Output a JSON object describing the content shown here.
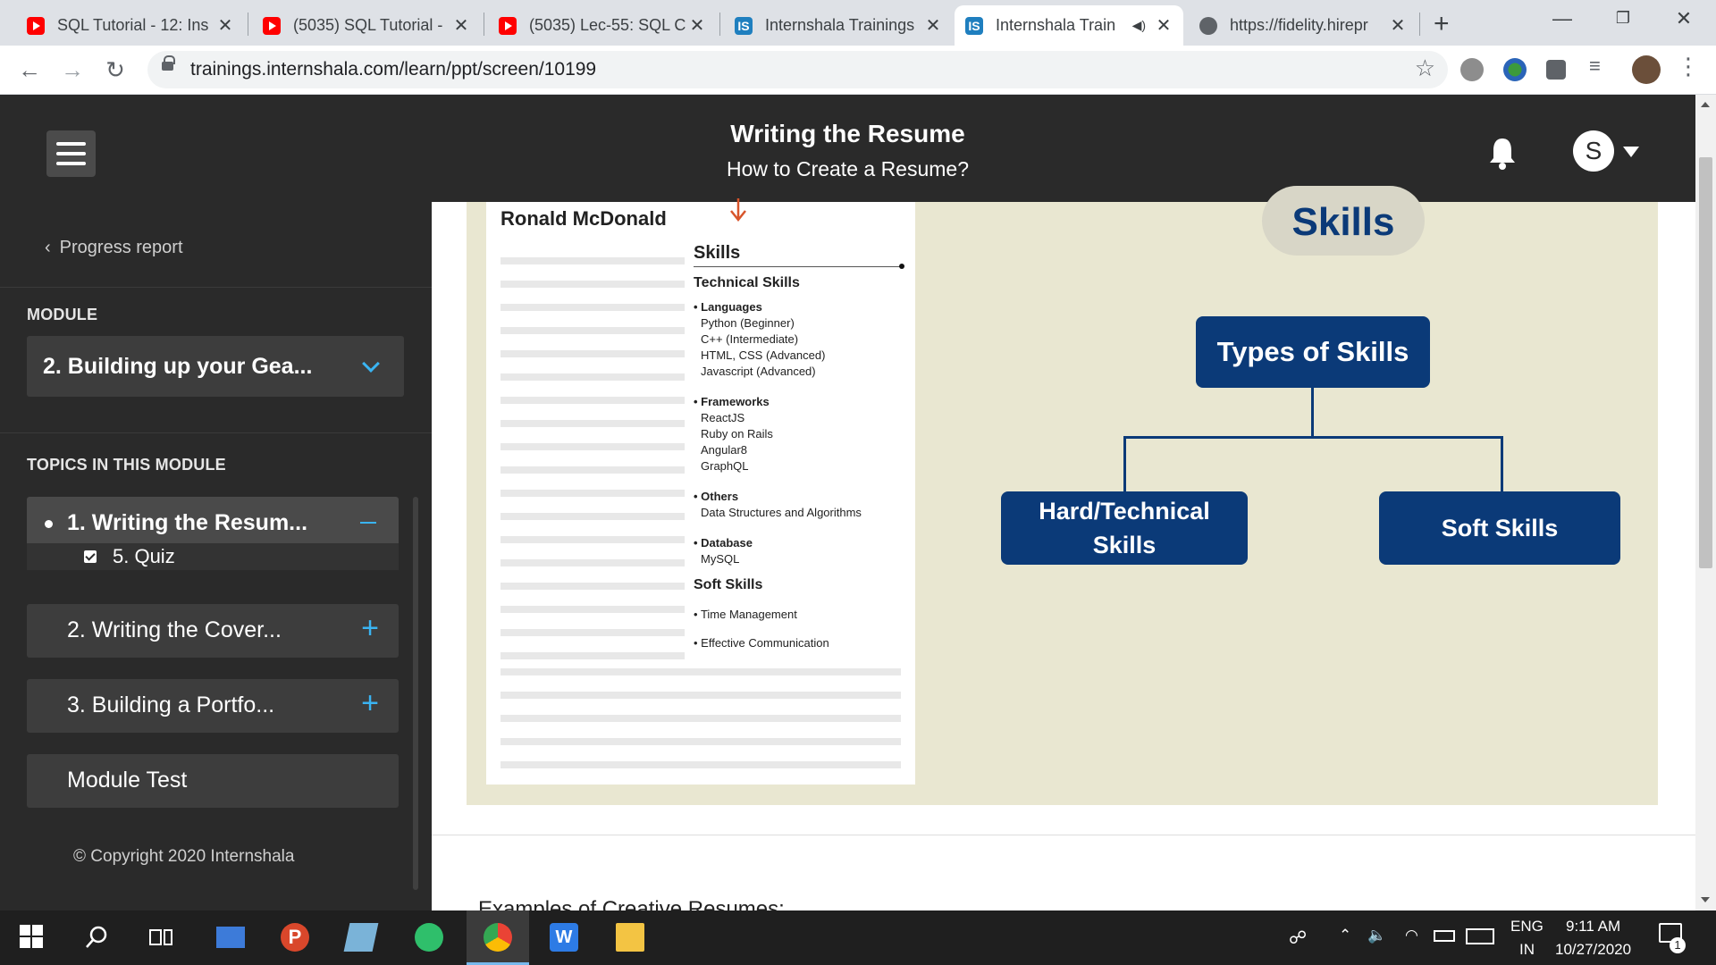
{
  "browser": {
    "tabs": [
      {
        "title": "SQL Tutorial - 12: Ins",
        "icon": "youtube-icon"
      },
      {
        "title": "(5035) SQL Tutorial -",
        "icon": "youtube-icon"
      },
      {
        "title": "(5035) Lec-55: SQL C",
        "icon": "youtube-icon"
      },
      {
        "title": "Internshala Trainings",
        "icon": "internshala-icon"
      },
      {
        "title": "Internshala Train",
        "icon": "internshala-icon"
      },
      {
        "title": "https://fidelity.hirepr",
        "icon": "globe-icon"
      }
    ],
    "url": "trainings.internshala.com/learn/ppt/screen/10199"
  },
  "header": {
    "title": "Writing the Resume",
    "subtitle": "How to Create a Resume?",
    "avatar_letter": "S"
  },
  "sidebar": {
    "progress_link": "Progress report",
    "module_label": "MODULE",
    "module_selected": "2. Building up your Gea...",
    "topics_label": "TOPICS IN THIS MODULE",
    "topics": [
      {
        "label": "1. Writing the Resum..."
      },
      {
        "label": "2. Writing the Cover..."
      },
      {
        "label": "3. Building a Portfo..."
      },
      {
        "label": "Module Test"
      }
    ],
    "subtopic": "5. Quiz",
    "copyright": "© Copyright 2020 Internshala"
  },
  "slide": {
    "resume": {
      "name": "Ronald McDonald",
      "skills_heading": "Skills",
      "technical_heading": "Technical Skills",
      "languages_label": "Languages",
      "languages": [
        "Python (Beginner)",
        "C++ (Intermediate)",
        "HTML, CSS (Advanced)",
        "Javascript (Advanced)"
      ],
      "frameworks_label": "Frameworks",
      "frameworks": [
        "ReactJS",
        "Ruby on Rails",
        "Angular8",
        "GraphQL"
      ],
      "others_label": "Others",
      "others": [
        "Data Structures and Algorithms"
      ],
      "database_label": "Database",
      "database": [
        "MySQL"
      ],
      "soft_heading": "Soft Skills",
      "soft": [
        "Time Management",
        "Effective Communication"
      ]
    },
    "diagram": {
      "pill": "Skills",
      "root": "Types of Skills",
      "left_line1": "Hard/Technical",
      "left_line2": "Skills",
      "right": "Soft Skills"
    }
  },
  "below_text": "Examples of Creative Resumes:",
  "taskbar": {
    "lang": "ENG",
    "region": "IN",
    "time": "9:11 AM",
    "date": "10/27/2020",
    "notif_count": "1"
  },
  "colors": {
    "header_bg": "#2a2a2a",
    "accent_blue": "#3ab4f2",
    "diagram_navy": "#0b3a78",
    "slide_bg": "#e9e7d1"
  }
}
